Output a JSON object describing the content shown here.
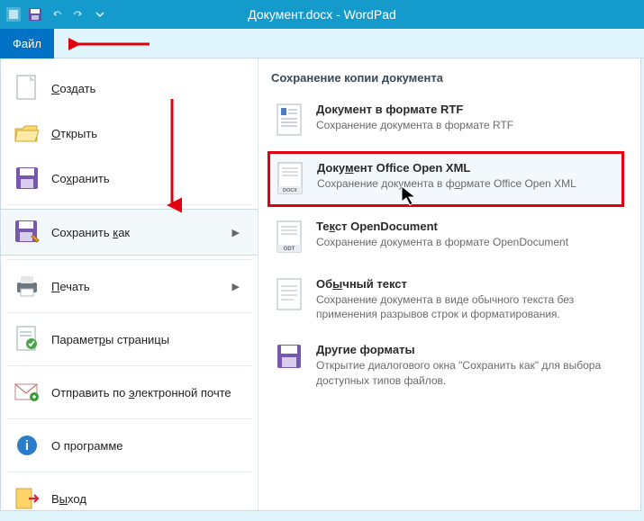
{
  "window": {
    "title": "Документ.docx - WordPad"
  },
  "ribbon": {
    "file_tab": "Файл"
  },
  "menu": {
    "create": "Создать",
    "open": "Открыть",
    "save": "Сохранить",
    "save_as": "Сохранить как",
    "print": "Печать",
    "page_setup": "Параметры страницы",
    "send_email": "Отправить по электронной почте",
    "about": "О программе",
    "exit": "Выход"
  },
  "panel": {
    "title": "Сохранение копии документа",
    "options": {
      "rtf": {
        "title": "Документ в формате RTF",
        "desc": "Сохранение документа в формате RTF"
      },
      "ooxml": {
        "title": "Документ Office Open XML",
        "desc": "Сохранение документа в формате Office Open XML"
      },
      "odt": {
        "title": "Текст OpenDocument",
        "desc": "Сохранение документа в формате OpenDocument"
      },
      "plain": {
        "title": "Обычный текст",
        "desc": "Сохранение документа в виде обычного текста без применения разрывов строк и форматирования."
      },
      "other": {
        "title": "Другие форматы",
        "desc": "Открытие диалогового окна \"Сохранить как\" для выбора доступных типов файлов."
      }
    }
  }
}
